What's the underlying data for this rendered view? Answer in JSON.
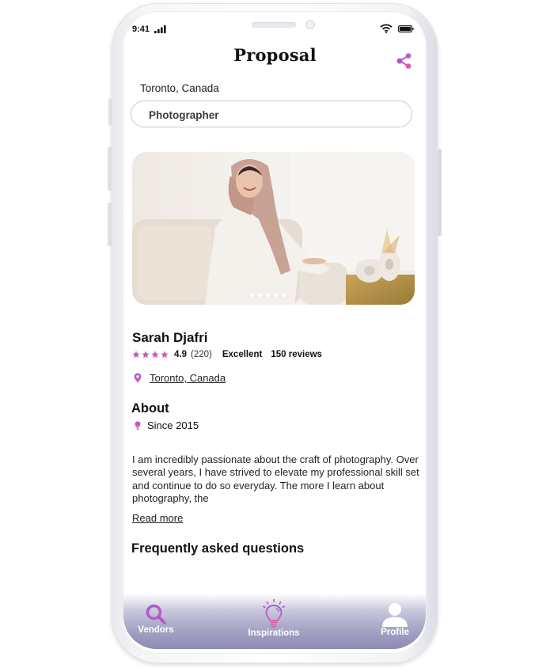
{
  "status_bar": {
    "time": "9:41",
    "signal_icon": "cellular-signal-icon",
    "wifi_icon": "wifi-icon",
    "battery_icon": "battery-full-icon"
  },
  "header": {
    "title": "Proposal",
    "share_icon": "share-icon"
  },
  "search": {
    "location": "Toronto, Canada",
    "query_value": "Photographer",
    "placeholder": "Photographer"
  },
  "gallery": {
    "image_description": "Smiling woman in pink hijab seated on a cream sofa",
    "slide_count": 5,
    "active_slide": 1
  },
  "vendor": {
    "name": "Sarah Djafri",
    "stars": 4,
    "rating": "4.9",
    "rating_count": "(220)",
    "rating_label": "Excellent",
    "reviews": "150 reviews",
    "location": "Toronto, Canada"
  },
  "about": {
    "heading": "About",
    "since": "Since 2015",
    "description": "I am incredibly passionate about the craft of photography. Over several years, I have strived to elevate my professional skill set and continue to do so everyday. The more I learn about photography, the",
    "read_more": "Read more"
  },
  "faq": {
    "heading": "Frequently asked questions"
  },
  "tabbar": {
    "tabs": [
      {
        "label": "Vendors",
        "icon": "search-icon"
      },
      {
        "label": "Inspirations",
        "icon": "lightbulb-icon"
      },
      {
        "label": "Profile",
        "icon": "user-icon"
      }
    ]
  },
  "colors": {
    "accent_purple": "#a35bd0",
    "accent_pink": "#e05aa8",
    "tabbar_bottom": "#8c8ab2"
  }
}
